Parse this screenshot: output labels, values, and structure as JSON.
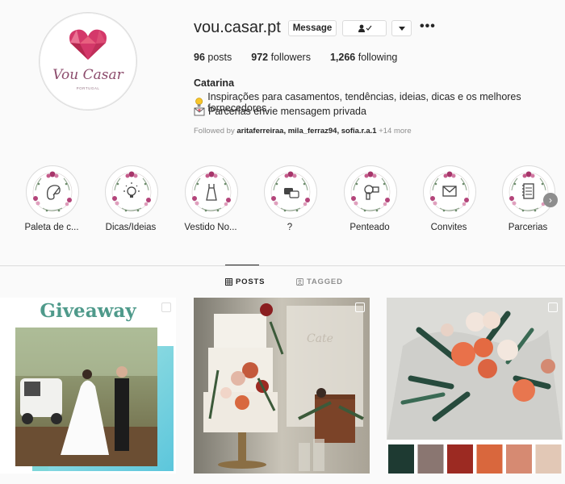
{
  "profile": {
    "username": "vou.casar.pt",
    "logo_text": "Vou Casar",
    "logo_subtext": "PORTUGAL",
    "message_button": "Message",
    "posts_count": "96",
    "posts_label": "posts",
    "followers_count": "972",
    "followers_label": "followers",
    "following_count": "1,266",
    "following_label": "following",
    "full_name": "Catarina",
    "bio_line1": "Inspirações para casamentos, tendências, ideias, dicas e os melhores fornecedores.",
    "bio_line2": "Parcerias envie mensagem privada",
    "followed_prefix": "Followed by",
    "followed_users": "aritaferreiraa, mila_ferraz94, sofia.r.a.1",
    "followed_more": "+14 more"
  },
  "highlights": [
    {
      "label": "Paleta de c...",
      "icon": "palette-icon"
    },
    {
      "label": "Dicas/Ideias",
      "icon": "lightbulb-icon"
    },
    {
      "label": "Vestido No...",
      "icon": "dress-icon"
    },
    {
      "label": "?",
      "icon": "chat-icon"
    },
    {
      "label": "Penteado",
      "icon": "hairdryer-icon"
    },
    {
      "label": "Convites",
      "icon": "envelope-icon"
    },
    {
      "label": "Parcerias",
      "icon": "notebook-icon"
    }
  ],
  "tabs": {
    "posts": "POSTS",
    "tagged": "TAGGED"
  },
  "posts": {
    "first_title": "Giveaway"
  },
  "colors": {
    "accent_text": "#262626",
    "muted": "#8e8e8e",
    "giveaway_green": "#4f9a8b",
    "palette": [
      "#1e3a32",
      "#8a7671",
      "#9c2a22",
      "#d9673d",
      "#d68a72",
      "#e2c8b6"
    ]
  }
}
